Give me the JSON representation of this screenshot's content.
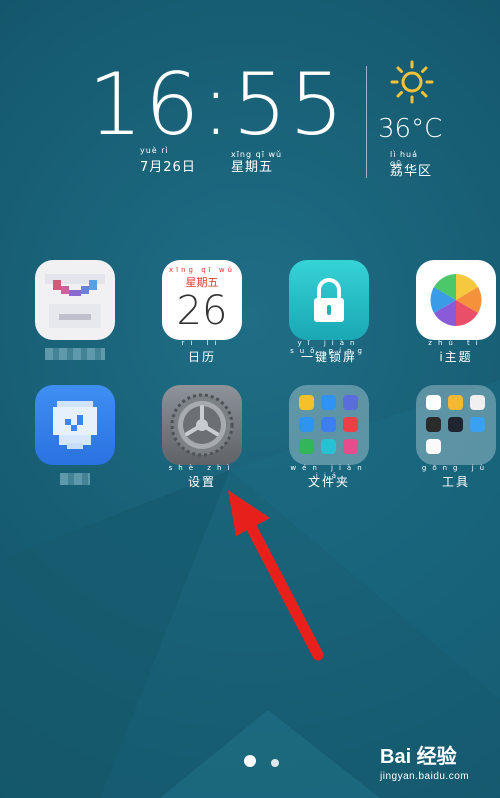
{
  "clock": {
    "time": "16:55",
    "date": "7月26日",
    "date_pinyin": "yuè        rì",
    "weekday": "星期五",
    "weekday_pinyin": "xīng qī wǔ"
  },
  "weather": {
    "icon": "sun-icon",
    "temperature": "36°C",
    "location": "荔华区",
    "location_pinyin": "lì huá qū"
  },
  "apps": [
    {
      "name": "pixelated-shopping-app",
      "label": "",
      "pinyin": "",
      "icon": "shopping-bag-icon"
    },
    {
      "name": "calendar-app",
      "label": "日历",
      "pinyin": "rì lì",
      "icon": "calendar-icon",
      "day": "26",
      "header": "星期五",
      "header_pinyin": "xīng qī wǔ"
    },
    {
      "name": "one-key-lock-app",
      "label": "一键锁屏",
      "pinyin": "yī jiàn suǒ píng",
      "icon": "lock-icon"
    },
    {
      "name": "themes-app",
      "label": "i主题",
      "pinyin": "zhǔ tí",
      "icon": "pinwheel-icon"
    },
    {
      "name": "pixelated-security-app",
      "label": "",
      "pinyin": "",
      "icon": "shield-check-icon"
    },
    {
      "name": "settings-app",
      "label": "设置",
      "pinyin": "shè zhì",
      "icon": "gear-icon"
    },
    {
      "name": "files-folder",
      "label": "文件夹",
      "pinyin": "wén jiàn jiá",
      "icon": "folder-icon"
    },
    {
      "name": "tools-folder",
      "label": "工具",
      "pinyin": "gōng jù",
      "icon": "folder-icon"
    }
  ],
  "page_indicator": {
    "total": 2,
    "current": 1
  },
  "watermark": {
    "brand": "Bai  经验",
    "sub": "jingyan.baidu.com"
  },
  "colors": {
    "accent_arrow": "#e8201c",
    "bg": "#175e74"
  }
}
